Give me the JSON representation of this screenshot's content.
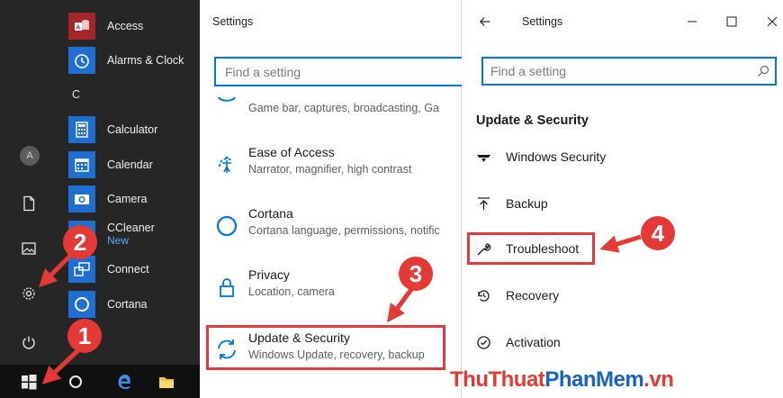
{
  "start_menu": {
    "letter_c": "C",
    "avatar_letter": "A",
    "apps": [
      {
        "name": "Access",
        "sub": ""
      },
      {
        "name": "Alarms & Clock",
        "sub": ""
      },
      {
        "name": "Calculator",
        "sub": ""
      },
      {
        "name": "Calendar",
        "sub": ""
      },
      {
        "name": "Camera",
        "sub": ""
      },
      {
        "name": "CCleaner",
        "sub": "New"
      },
      {
        "name": "Connect",
        "sub": ""
      },
      {
        "name": "Cortana",
        "sub": ""
      }
    ]
  },
  "settings_mid": {
    "title": "Settings",
    "search_placeholder": "Find a setting",
    "categories": [
      {
        "title": "",
        "desc": "Game bar, captures, broadcasting, Ga"
      },
      {
        "title": "Ease of Access",
        "desc": "Narrator, magnifier, high contrast"
      },
      {
        "title": "Cortana",
        "desc": "Cortana language, permissions, notific"
      },
      {
        "title": "Privacy",
        "desc": "Location, camera"
      },
      {
        "title": "Update & Security",
        "desc": "Windows Update, recovery, backup"
      }
    ]
  },
  "settings_right": {
    "title": "Settings",
    "search_placeholder": "Find a setting",
    "section_heading": "Update & Security",
    "nav": [
      {
        "label": "Windows Security"
      },
      {
        "label": "Backup"
      },
      {
        "label": "Troubleshoot"
      },
      {
        "label": "Recovery"
      },
      {
        "label": "Activation"
      }
    ]
  },
  "annotations": {
    "step1": "1",
    "step2": "2",
    "step3": "3",
    "step4": "4"
  },
  "watermark": {
    "part1": "ThuThuat",
    "part2": "PhanMem",
    "part3": ".vn"
  },
  "colors": {
    "accent_blue": "#0078d7",
    "highlight_red": "#e03b3b",
    "start_bg": "#262626",
    "tile_blue": "#1e6fd0",
    "access_red": "#a4262c"
  }
}
